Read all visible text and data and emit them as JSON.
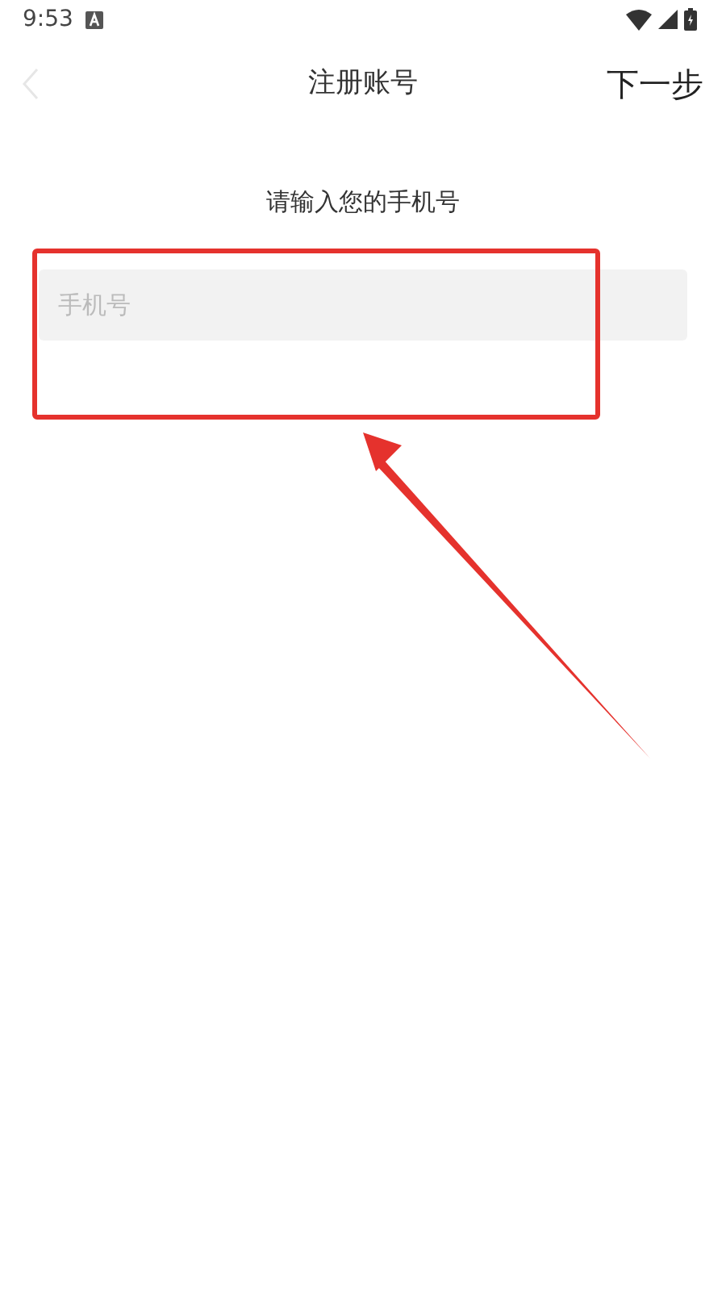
{
  "status_bar": {
    "time": "9:53"
  },
  "nav": {
    "title": "注册账号",
    "next_button": "下一步",
    "back_disabled": true
  },
  "prompt": "请输入您的手机号",
  "phone_field": {
    "placeholder": "手机号"
  },
  "annotation": {
    "kind": "highlight-with-arrow"
  }
}
